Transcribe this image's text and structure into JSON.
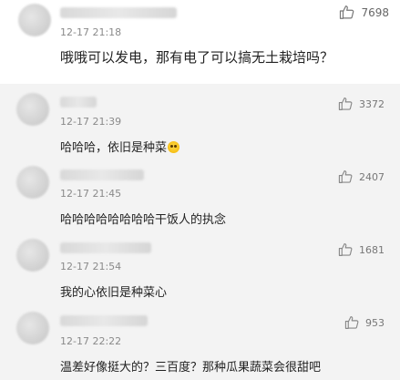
{
  "main_comment": {
    "time": "12-17 21:18",
    "text": "哦哦可以发电，那有电了可以搞无土栽培吗？",
    "likes": "7698"
  },
  "replies": [
    {
      "time": "12-17 21:39",
      "text": "哈哈哈，依旧是种菜",
      "likes": "3372"
    },
    {
      "time": "12-17 21:45",
      "text": "哈哈哈哈哈哈哈哈干饭人的执念",
      "likes": "2407"
    },
    {
      "time": "12-17 21:54",
      "text": "我的心依旧是种菜心",
      "likes": "1681"
    },
    {
      "time": "12-17 22:22",
      "text": "温差好像挺大的？三百度？那种瓜果蔬菜会很甜吧",
      "likes": "953"
    }
  ],
  "icons": {
    "like": "thumbs-up-icon",
    "emoji": "emoji-icon"
  },
  "watermark": "瓜果蔬菜会很甜吧"
}
